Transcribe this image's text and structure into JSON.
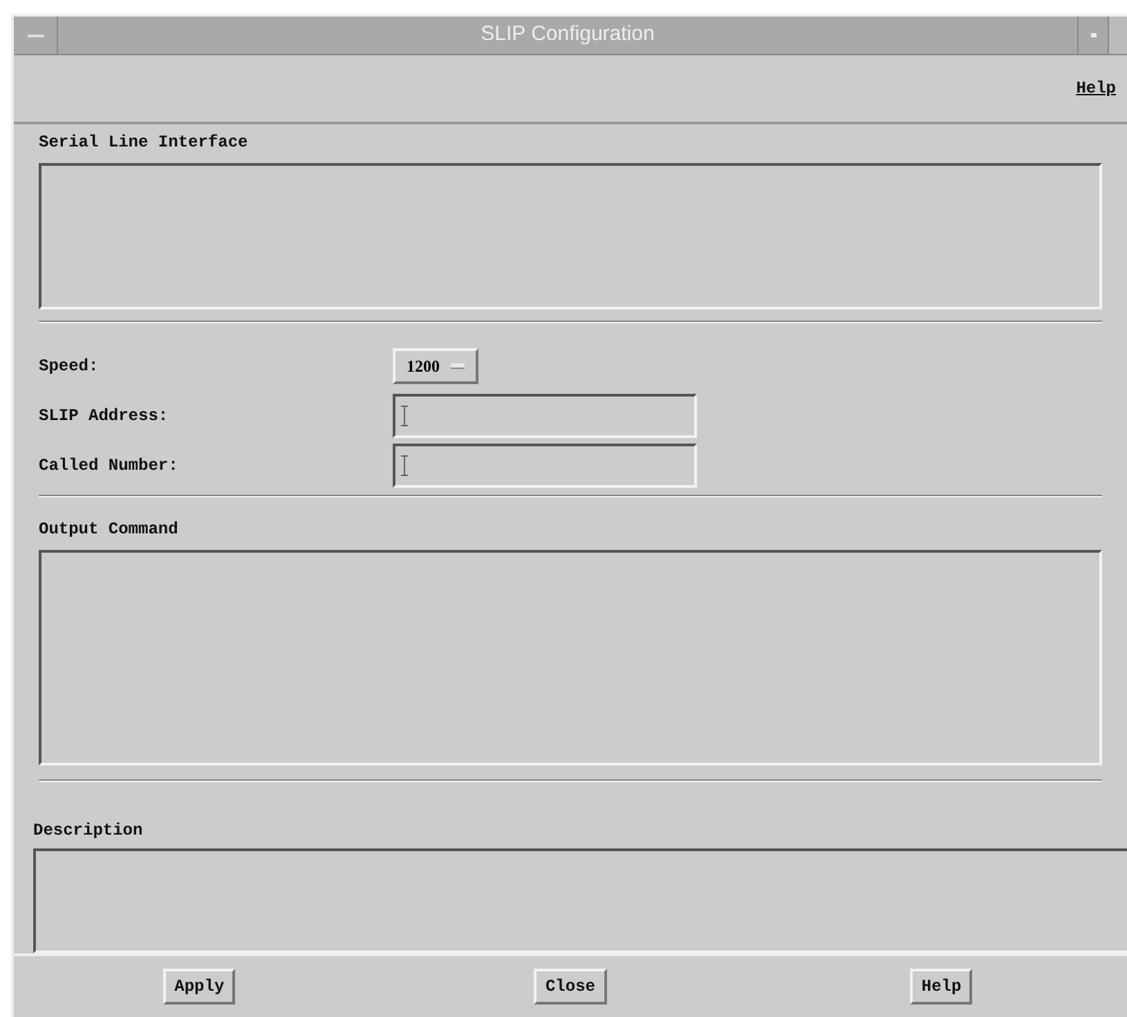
{
  "window": {
    "title": "SLIP Configuration"
  },
  "menu_bar": {
    "items": [
      "Help"
    ]
  },
  "serial_line_interface": {
    "label": "Serial Line Interface"
  },
  "form": [
    {
      "kind": "option",
      "label": "Speed:",
      "value": "1200"
    },
    {
      "kind": "text",
      "label": "SLIP Address:"
    },
    {
      "kind": "text",
      "label": "Called Number:"
    }
  ],
  "output_command": {
    "label": "Output Command"
  },
  "description": {
    "label": "Description"
  },
  "buttons": [
    "Apply",
    "Close",
    "Help"
  ]
}
